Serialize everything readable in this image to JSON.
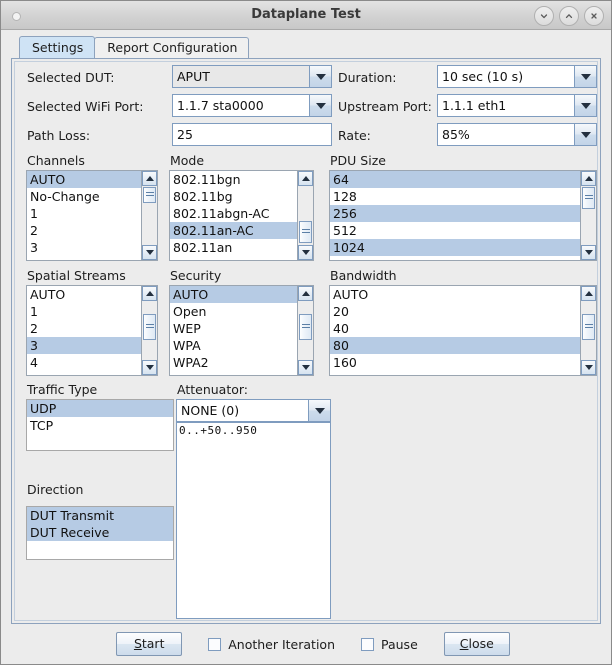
{
  "window": {
    "title": "Dataplane Test",
    "buttons": [
      {
        "name": "minimize-button",
        "icon": "chevron-down-icon"
      },
      {
        "name": "maximize-button",
        "icon": "chevron-up-icon"
      },
      {
        "name": "close-button",
        "icon": "close-x-icon"
      }
    ]
  },
  "tabs": [
    {
      "label": "Settings",
      "active": true
    },
    {
      "label": "Report Configuration",
      "active": false
    }
  ],
  "fields": {
    "selected_dut": {
      "label": "Selected DUT:",
      "value": "APUT",
      "type": "combobox"
    },
    "duration": {
      "label": "Duration:",
      "value": "10 sec (10 s)",
      "type": "combobox"
    },
    "selected_wifi_port": {
      "label": "Selected WiFi Port:",
      "value": "1.1.7 sta0000",
      "type": "combobox"
    },
    "upstream_port": {
      "label": "Upstream Port:",
      "value": "1.1.1 eth1",
      "type": "combobox"
    },
    "path_loss": {
      "label": "Path Loss:",
      "value": "25",
      "type": "textfield"
    },
    "rate": {
      "label": "Rate:",
      "value": "85%",
      "type": "combobox"
    }
  },
  "lists": {
    "channels": {
      "label": "Channels",
      "items": [
        {
          "text": "AUTO",
          "selected": true
        },
        {
          "text": "No-Change",
          "selected": false
        },
        {
          "text": "1",
          "selected": false
        },
        {
          "text": "2",
          "selected": false
        },
        {
          "text": "3",
          "selected": false
        }
      ]
    },
    "mode": {
      "label": "Mode",
      "items": [
        {
          "text": "802.11bgn",
          "selected": false
        },
        {
          "text": "802.11bg",
          "selected": false
        },
        {
          "text": "802.11abgn-AC",
          "selected": false
        },
        {
          "text": "802.11an-AC",
          "selected": true
        },
        {
          "text": "802.11an",
          "selected": false
        }
      ]
    },
    "pdu_size": {
      "label": "PDU Size",
      "items": [
        {
          "text": "64",
          "selected": true
        },
        {
          "text": "128",
          "selected": false
        },
        {
          "text": "256",
          "selected": true
        },
        {
          "text": "512",
          "selected": false
        },
        {
          "text": "1024",
          "selected": true
        }
      ]
    },
    "spatial_streams": {
      "label": "Spatial Streams",
      "items": [
        {
          "text": "AUTO",
          "selected": false
        },
        {
          "text": "1",
          "selected": false
        },
        {
          "text": "2",
          "selected": false
        },
        {
          "text": "3",
          "selected": true
        },
        {
          "text": "4",
          "selected": false
        }
      ]
    },
    "security": {
      "label": "Security",
      "items": [
        {
          "text": "AUTO",
          "selected": true
        },
        {
          "text": "Open",
          "selected": false
        },
        {
          "text": "WEP",
          "selected": false
        },
        {
          "text": "WPA",
          "selected": false
        },
        {
          "text": "WPA2",
          "selected": false
        }
      ]
    },
    "bandwidth": {
      "label": "Bandwidth",
      "items": [
        {
          "text": "AUTO",
          "selected": false
        },
        {
          "text": "20",
          "selected": false
        },
        {
          "text": "40",
          "selected": false
        },
        {
          "text": "80",
          "selected": true
        },
        {
          "text": "160",
          "selected": false
        }
      ]
    },
    "traffic_type": {
      "label": "Traffic Type",
      "items": [
        {
          "text": "UDP",
          "selected": true
        },
        {
          "text": "TCP",
          "selected": false
        }
      ]
    },
    "direction": {
      "label": "Direction",
      "items": [
        {
          "text": "DUT Transmit",
          "selected": true
        },
        {
          "text": "DUT Receive",
          "selected": true
        }
      ]
    }
  },
  "attenuator": {
    "label": "Attenuator:",
    "value": "NONE (0)",
    "detail": "0..+50..950"
  },
  "bottom": {
    "start_label": "Start",
    "start_mnemonic": "S",
    "start_rest": "tart",
    "another_iteration_label": "Another Iteration",
    "another_iteration_checked": false,
    "pause_label": "Pause",
    "pause_checked": false,
    "close_mnemonic": "C",
    "close_rest": "lose",
    "close_label": "Close"
  },
  "colors": {
    "selection": "#b6cbe4",
    "tab_active": "#cfe3f5",
    "panel_border": "#8da2bd",
    "window_bg": "#ececec"
  }
}
